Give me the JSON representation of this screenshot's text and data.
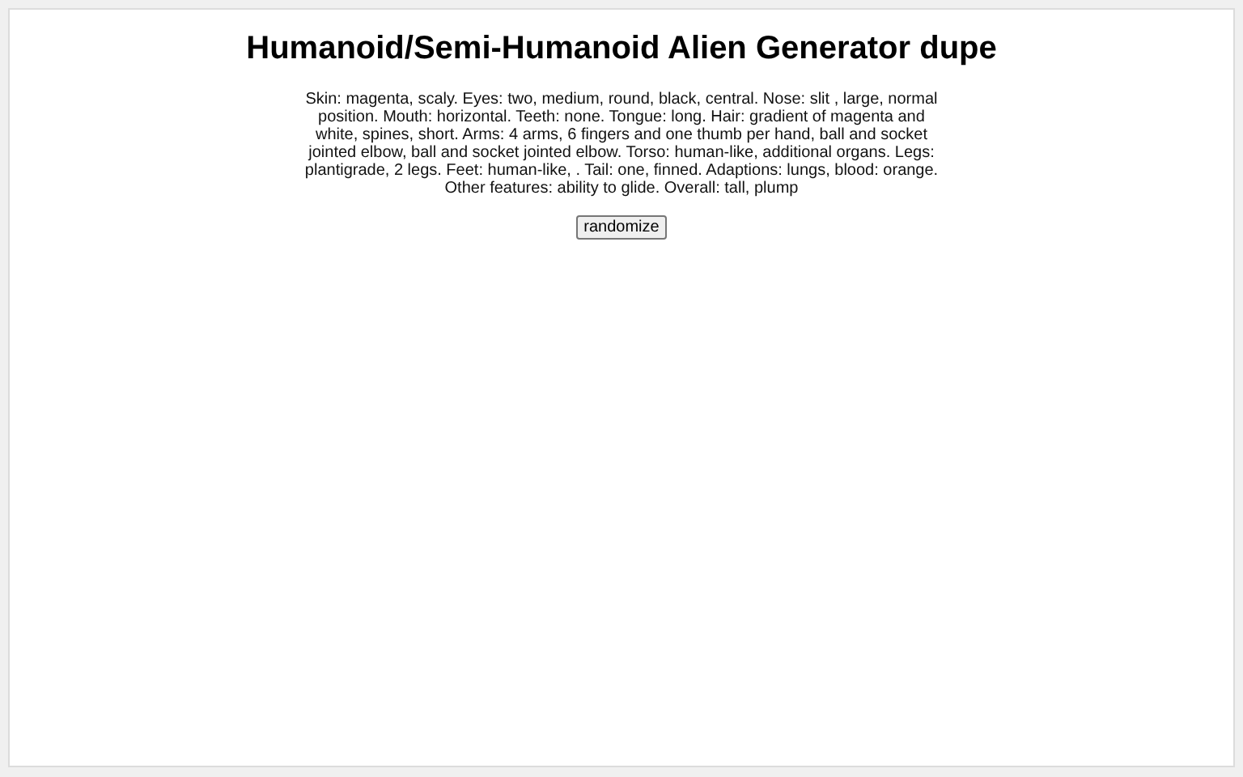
{
  "title": "Humanoid/Semi-Humanoid Alien Generator dupe",
  "description": "Skin: magenta, scaly. Eyes: two, medium, round, black, central. Nose: slit , large, normal position. Mouth: horizontal. Teeth: none. Tongue: long. Hair: gradient of magenta and white, spines, short. Arms: 4 arms, 6 fingers and one thumb per hand, ball and socket jointed elbow, ball and socket jointed elbow. Torso: human-like, additional organs. Legs: plantigrade, 2 legs. Feet: human-like, . Tail: one, finned. Adaptions: lungs, blood: orange. Other features: ability to glide. Overall: tall, plump",
  "button": "randomize"
}
